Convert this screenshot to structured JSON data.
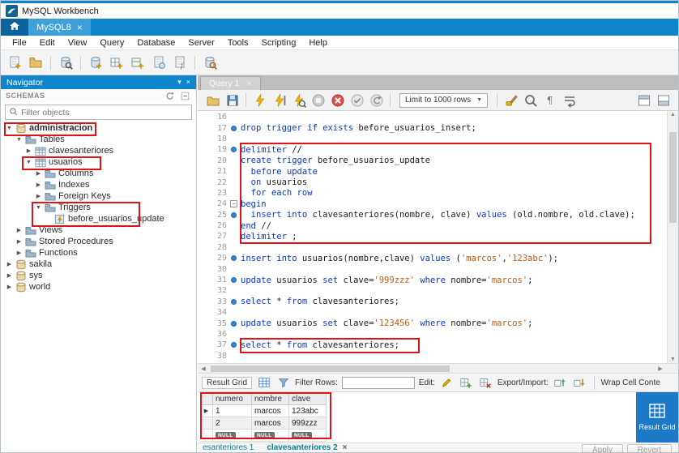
{
  "window": {
    "title": "MySQL Workbench"
  },
  "connection_tabs": [
    {
      "label": "MySQL8",
      "close": "×"
    }
  ],
  "menubar": {
    "items": [
      "File",
      "Edit",
      "View",
      "Query",
      "Database",
      "Server",
      "Tools",
      "Scripting",
      "Help"
    ]
  },
  "main_toolbar": {
    "icons": [
      "new-query-tab",
      "open-sql-script",
      "|",
      "inspector",
      "|",
      "create-schema",
      "create-table",
      "create-view",
      "create-procedure",
      "create-function",
      "|",
      "search-database"
    ]
  },
  "navigator": {
    "title": "Navigator",
    "header_icons": [
      "refresh",
      "collapse-all"
    ],
    "section": "SCHEMAS",
    "filter_placeholder": "Filter objects",
    "tree": [
      {
        "label": "administracion",
        "indent": 0,
        "icon": "schema",
        "arrow": "open",
        "bold": true,
        "boxed": true
      },
      {
        "label": "Tables",
        "indent": 1,
        "icon": "folder",
        "arrow": "open"
      },
      {
        "label": "clavesanteriores",
        "indent": 2,
        "icon": "table",
        "arrow": "closed"
      },
      {
        "label": "usuarios",
        "indent": 2,
        "icon": "table",
        "arrow": "open",
        "boxed": true
      },
      {
        "label": "Columns",
        "indent": 3,
        "icon": "folder",
        "arrow": "closed"
      },
      {
        "label": "Indexes",
        "indent": 3,
        "icon": "folder",
        "arrow": "closed"
      },
      {
        "label": "Foreign Keys",
        "indent": 3,
        "icon": "folder",
        "arrow": "closed"
      },
      {
        "label": "Triggers",
        "indent": 3,
        "icon": "folder",
        "arrow": "open",
        "boxed": true
      },
      {
        "label": "before_usuarios_update",
        "indent": 4,
        "icon": "trigger",
        "arrow": "none"
      },
      {
        "label": "Views",
        "indent": 1,
        "icon": "folder",
        "arrow": "closed"
      },
      {
        "label": "Stored Procedures",
        "indent": 1,
        "icon": "folder",
        "arrow": "closed"
      },
      {
        "label": "Functions",
        "indent": 1,
        "icon": "folder",
        "arrow": "closed"
      },
      {
        "label": "sakila",
        "indent": 0,
        "icon": "schema",
        "arrow": "closed"
      },
      {
        "label": "sys",
        "indent": 0,
        "icon": "schema",
        "arrow": "closed"
      },
      {
        "label": "world",
        "indent": 0,
        "icon": "schema",
        "arrow": "closed"
      }
    ]
  },
  "editor": {
    "tab_label": "Query 1",
    "tab_close": "×",
    "limit_dropdown": "Limit to 1000 rows",
    "toolbar_items": [
      "open-file",
      "save-script",
      "|",
      "execute",
      "execute-current",
      "explain",
      "stop",
      "toggle-stop-on-error",
      "commit",
      "rollback",
      "|",
      {
        "type": "dropdown"
      },
      "|",
      "beautify",
      "find",
      "invisible-characters",
      "wrap-text",
      {
        "type": "spacer"
      },
      "collapse-editor",
      "panel-toggle"
    ],
    "lines": [
      {
        "num": 16,
        "tokens": []
      },
      {
        "num": 17,
        "marker": true,
        "tokens": [
          {
            "t": "drop trigger if exists ",
            "c": "kw"
          },
          {
            "t": "before_usuarios_insert;",
            "c": "id"
          }
        ]
      },
      {
        "num": 18,
        "tokens": []
      },
      {
        "num": 19,
        "marker": true,
        "tokens": [
          {
            "t": "delimiter ",
            "c": "kw"
          },
          {
            "t": "//",
            "c": "id"
          }
        ]
      },
      {
        "num": 20,
        "tokens": [
          {
            "t": "create trigger ",
            "c": "kw"
          },
          {
            "t": "before_usuarios_update",
            "c": "id"
          }
        ]
      },
      {
        "num": 21,
        "tokens": [
          {
            "t": "  ",
            "c": "id"
          },
          {
            "t": "before update",
            "c": "kw"
          }
        ]
      },
      {
        "num": 22,
        "tokens": [
          {
            "t": "  ",
            "c": "id"
          },
          {
            "t": "on ",
            "c": "kw"
          },
          {
            "t": "usuarios",
            "c": "id"
          }
        ]
      },
      {
        "num": 23,
        "tokens": [
          {
            "t": "  ",
            "c": "id"
          },
          {
            "t": "for each row",
            "c": "kw"
          }
        ]
      },
      {
        "num": 24,
        "fold": true,
        "tokens": [
          {
            "t": "begin",
            "c": "kw"
          }
        ]
      },
      {
        "num": 25,
        "marker": true,
        "tokens": [
          {
            "t": "  ",
            "c": "id"
          },
          {
            "t": "insert into ",
            "c": "kw"
          },
          {
            "t": "clavesanteriores(nombre, clave) ",
            "c": "id"
          },
          {
            "t": "values ",
            "c": "kw"
          },
          {
            "t": "(old.nombre, old.clave);",
            "c": "id"
          }
        ]
      },
      {
        "num": 26,
        "tokens": [
          {
            "t": "end ",
            "c": "kw"
          },
          {
            "t": "//",
            "c": "id"
          }
        ]
      },
      {
        "num": 27,
        "tokens": [
          {
            "t": "delimiter ",
            "c": "kw"
          },
          {
            "t": ";",
            "c": "id"
          }
        ]
      },
      {
        "num": 28,
        "tokens": []
      },
      {
        "num": 29,
        "marker": true,
        "tokens": [
          {
            "t": "insert into ",
            "c": "kw"
          },
          {
            "t": "usuarios(nombre,clave) ",
            "c": "id"
          },
          {
            "t": "values ",
            "c": "kw"
          },
          {
            "t": "(",
            "c": "id"
          },
          {
            "t": "'marcos'",
            "c": "str"
          },
          {
            "t": ",",
            "c": "id"
          },
          {
            "t": "'123abc'",
            "c": "str"
          },
          {
            "t": ");",
            "c": "id"
          }
        ]
      },
      {
        "num": 30,
        "tokens": []
      },
      {
        "num": 31,
        "marker": true,
        "tokens": [
          {
            "t": "update ",
            "c": "kw"
          },
          {
            "t": "usuarios ",
            "c": "id"
          },
          {
            "t": "set ",
            "c": "kw"
          },
          {
            "t": "clave=",
            "c": "id"
          },
          {
            "t": "'999zzz'",
            "c": "str"
          },
          {
            "t": " ",
            "c": "id"
          },
          {
            "t": "where ",
            "c": "kw"
          },
          {
            "t": "nombre=",
            "c": "id"
          },
          {
            "t": "'marcos'",
            "c": "str"
          },
          {
            "t": ";",
            "c": "id"
          }
        ]
      },
      {
        "num": 32,
        "tokens": []
      },
      {
        "num": 33,
        "marker": true,
        "tokens": [
          {
            "t": "select ",
            "c": "kw"
          },
          {
            "t": "* ",
            "c": "id"
          },
          {
            "t": "from ",
            "c": "kw"
          },
          {
            "t": "clavesanteriores;",
            "c": "id"
          }
        ]
      },
      {
        "num": 34,
        "tokens": []
      },
      {
        "num": 35,
        "marker": true,
        "tokens": [
          {
            "t": "update ",
            "c": "kw"
          },
          {
            "t": "usuarios ",
            "c": "id"
          },
          {
            "t": "set ",
            "c": "kw"
          },
          {
            "t": "clave=",
            "c": "id"
          },
          {
            "t": "'123456'",
            "c": "str"
          },
          {
            "t": " ",
            "c": "id"
          },
          {
            "t": "where ",
            "c": "kw"
          },
          {
            "t": "nombre=",
            "c": "id"
          },
          {
            "t": "'marcos'",
            "c": "str"
          },
          {
            "t": ";",
            "c": "id"
          }
        ]
      },
      {
        "num": 36,
        "tokens": []
      },
      {
        "num": 37,
        "marker": true,
        "tokens": [
          {
            "t": "select ",
            "c": "kw"
          },
          {
            "t": "* ",
            "c": "id"
          },
          {
            "t": "from ",
            "c": "kw"
          },
          {
            "t": "clavesanteriores;",
            "c": "id"
          }
        ]
      },
      {
        "num": 38,
        "tokens": []
      }
    ]
  },
  "result": {
    "toolbar_items": [
      {
        "type": "label",
        "text": "Result Grid",
        "name": "result-grid-label",
        "boxed": true
      },
      {
        "type": "icon",
        "name": "grid"
      },
      {
        "type": "icon",
        "name": "filter"
      },
      {
        "type": "label",
        "text": "Filter Rows:",
        "name": "filter-rows-label"
      },
      {
        "type": "input",
        "value": "",
        "name": "filter-rows-input"
      },
      {
        "type": "label",
        "text": "Edit:",
        "name": "edit-label"
      },
      {
        "type": "icon",
        "name": "edit-pencil"
      },
      {
        "type": "icon",
        "name": "insert-row"
      },
      {
        "type": "icon",
        "name": "delete-row"
      },
      {
        "type": "label",
        "text": "Export/Import:",
        "name": "export-import-label"
      },
      {
        "type": "icon",
        "name": "export"
      },
      {
        "type": "icon",
        "name": "import"
      },
      {
        "type": "sep"
      },
      {
        "type": "label",
        "text": "Wrap Cell Conte",
        "name": "wrap-cell-content-label"
      }
    ],
    "columns": [
      "numero",
      "nombre",
      "clave"
    ],
    "rows": [
      [
        "1",
        "marcos",
        "123abc"
      ],
      [
        "2",
        "marcos",
        "999zzz"
      ],
      [
        "NULL",
        "NULL",
        "NULL"
      ]
    ],
    "current_row": 0,
    "sidebar_label": "Result Grid",
    "apply_label": "Apply",
    "revert_label": "Revert"
  },
  "bottom_tabs": [
    {
      "label": "esanteriores 1",
      "active": false
    },
    {
      "label": "clavesanteriores 2",
      "close": "×",
      "active": true
    }
  ],
  "colors": {
    "accent": "#0f86cc",
    "kw": "#0a37cc",
    "str": "#c05a12",
    "marker": "#2e86d4",
    "anno": "#e01414",
    "sidebar_blue": "#1b79c7",
    "bottom_tab_teal": "#0a7f8f"
  }
}
